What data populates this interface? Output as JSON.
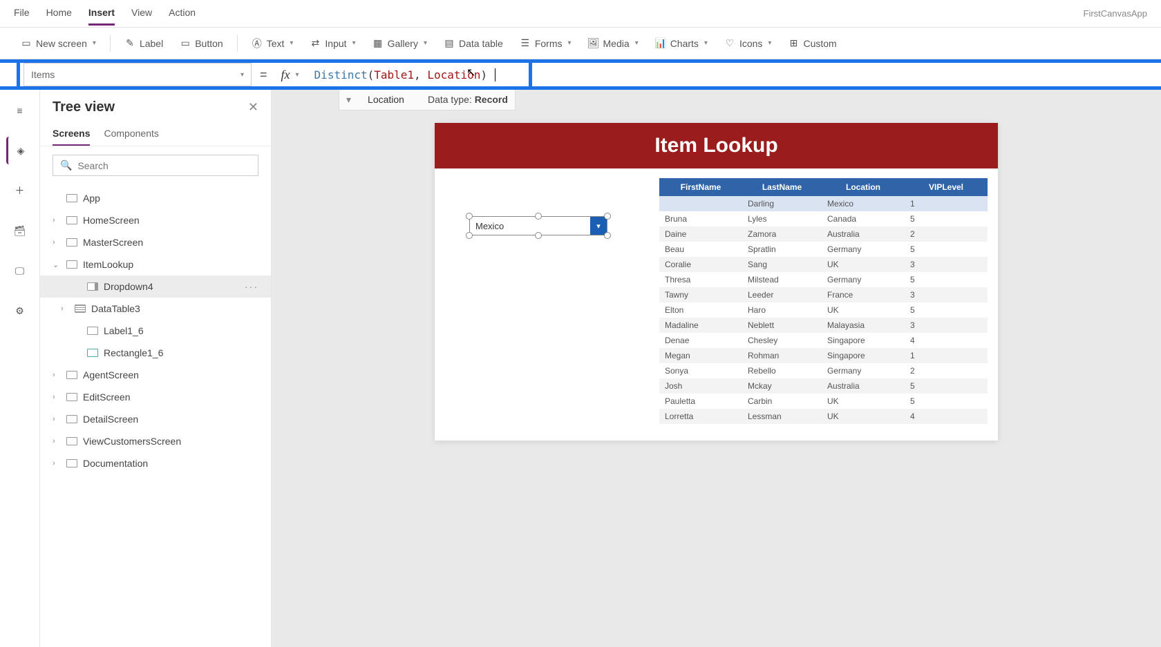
{
  "app_name": "FirstCanvasApp",
  "menu": {
    "items": [
      "File",
      "Home",
      "Insert",
      "View",
      "Action"
    ],
    "active": "Insert"
  },
  "toolbar": {
    "new_screen": "New screen",
    "label": "Label",
    "button": "Button",
    "text": "Text",
    "input": "Input",
    "gallery": "Gallery",
    "data_table": "Data table",
    "forms": "Forms",
    "media": "Media",
    "charts": "Charts",
    "icons": "Icons",
    "custom": "Custom"
  },
  "formula": {
    "property": "Items",
    "fn": "Distinct",
    "table": "Table1",
    "column": "Location",
    "hint_field": "Location",
    "hint_type_label": "Data type:",
    "hint_type": "Record"
  },
  "tree": {
    "title": "Tree view",
    "tabs": [
      "Screens",
      "Components"
    ],
    "active_tab": "Screens",
    "search_placeholder": "Search",
    "app_label": "App",
    "items": [
      {
        "label": "HomeScreen"
      },
      {
        "label": "MasterScreen"
      },
      {
        "label": "ItemLookup",
        "expanded": true,
        "children": [
          {
            "label": "Dropdown4",
            "selected": true,
            "icon": "dropdown"
          },
          {
            "label": "DataTable3",
            "icon": "table",
            "hasChildren": true
          },
          {
            "label": "Label1_6",
            "icon": "label"
          },
          {
            "label": "Rectangle1_6",
            "icon": "rect"
          }
        ]
      },
      {
        "label": "AgentScreen"
      },
      {
        "label": "EditScreen"
      },
      {
        "label": "DetailScreen"
      },
      {
        "label": "ViewCustomersScreen"
      },
      {
        "label": "Documentation"
      }
    ]
  },
  "canvas": {
    "title": "Item Lookup",
    "dropdown_value": "Mexico",
    "table": {
      "headers": [
        "FirstName",
        "LastName",
        "Location",
        "VIPLevel"
      ],
      "rows": [
        [
          "",
          "Darling",
          "Mexico",
          "1"
        ],
        [
          "Bruna",
          "Lyles",
          "Canada",
          "5"
        ],
        [
          "Daine",
          "Zamora",
          "Australia",
          "2"
        ],
        [
          "Beau",
          "Spratlin",
          "Germany",
          "5"
        ],
        [
          "Coralie",
          "Sang",
          "UK",
          "3"
        ],
        [
          "Thresa",
          "Milstead",
          "Germany",
          "5"
        ],
        [
          "Tawny",
          "Leeder",
          "France",
          "3"
        ],
        [
          "Elton",
          "Haro",
          "UK",
          "5"
        ],
        [
          "Madaline",
          "Neblett",
          "Malayasia",
          "3"
        ],
        [
          "Denae",
          "Chesley",
          "Singapore",
          "4"
        ],
        [
          "Megan",
          "Rohman",
          "Singapore",
          "1"
        ],
        [
          "Sonya",
          "Rebello",
          "Germany",
          "2"
        ],
        [
          "Josh",
          "Mckay",
          "Australia",
          "5"
        ],
        [
          "Pauletta",
          "Carbin",
          "UK",
          "5"
        ],
        [
          "Lorretta",
          "Lessman",
          "UK",
          "4"
        ]
      ]
    }
  }
}
